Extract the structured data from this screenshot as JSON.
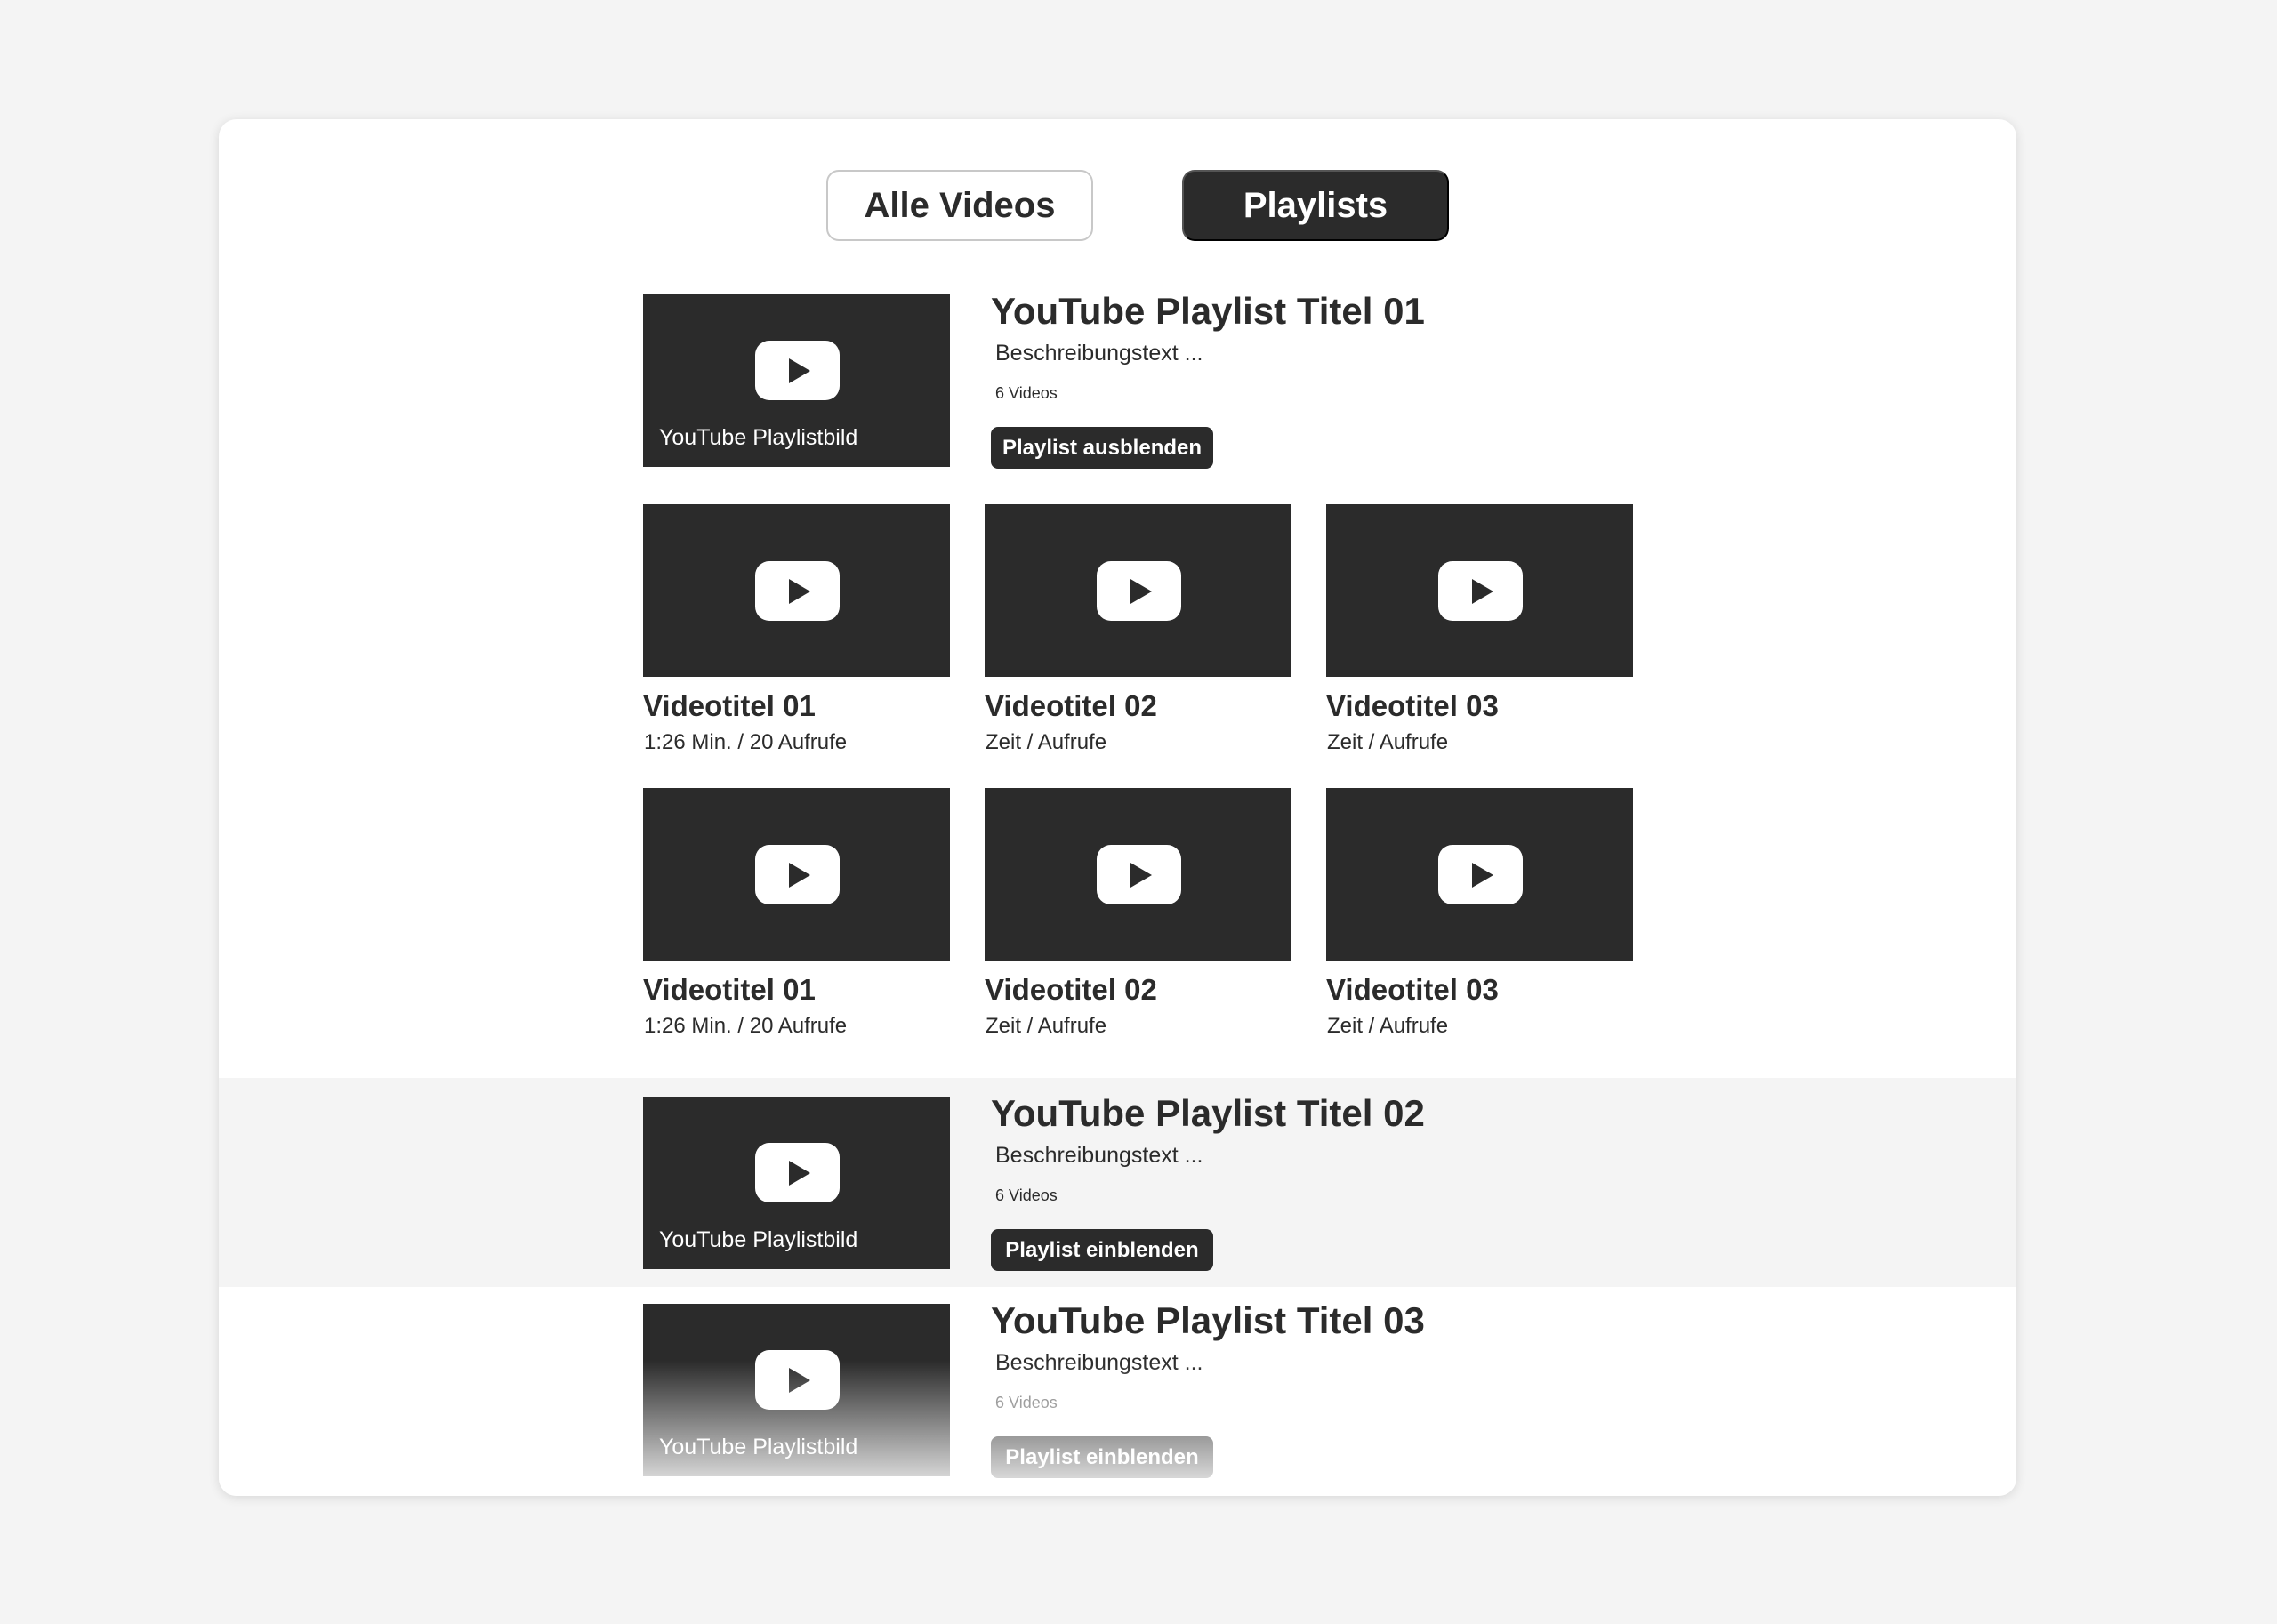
{
  "tabs": [
    {
      "label": "Alle Videos",
      "active": false
    },
    {
      "label": "Playlists",
      "active": true
    }
  ],
  "colors": {
    "dark": "#2b2b2b",
    "background": "#f4f4f4",
    "card": "#ffffff"
  },
  "playlists": [
    {
      "thumb_label": "YouTube Playlistbild",
      "title": "YouTube Playlist Titel 01",
      "description": "Beschreibungstext ...",
      "count": "6 Videos",
      "button": "Playlist ausblenden",
      "expanded": true,
      "videos": [
        {
          "title": "Videotitel 01",
          "meta": "1:26 Min. / 20 Aufrufe"
        },
        {
          "title": "Videotitel 02",
          "meta": "Zeit / Aufrufe"
        },
        {
          "title": "Videotitel 03",
          "meta": "Zeit / Aufrufe"
        },
        {
          "title": "Videotitel 01",
          "meta": "1:26 Min. / 20 Aufrufe"
        },
        {
          "title": "Videotitel 02",
          "meta": "Zeit / Aufrufe"
        },
        {
          "title": "Videotitel 03",
          "meta": "Zeit / Aufrufe"
        }
      ]
    },
    {
      "thumb_label": "YouTube Playlistbild",
      "title": "YouTube Playlist Titel 02",
      "description": "Beschreibungstext ...",
      "count": "6 Videos",
      "button": "Playlist einblenden",
      "expanded": false
    },
    {
      "thumb_label": "YouTube Playlistbild",
      "title": "YouTube Playlist Titel 03",
      "description": "Beschreibungstext ...",
      "count": "6 Videos",
      "button": "Playlist einblenden",
      "expanded": false
    }
  ]
}
